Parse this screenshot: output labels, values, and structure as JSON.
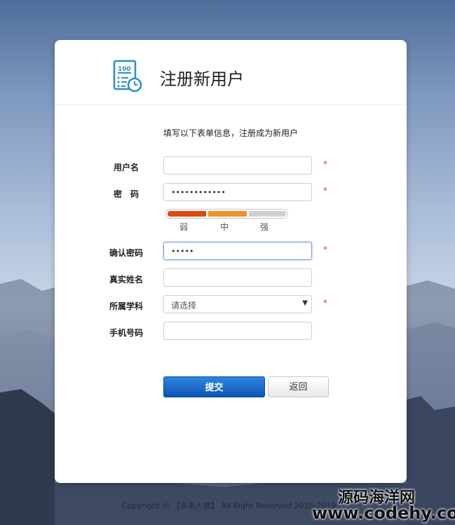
{
  "header": {
    "title": "注册新用户",
    "logo_icon": "exam-score-icon",
    "logo_text": "100"
  },
  "subtitle": "填写以下表单信息，注册成为新用户",
  "form": {
    "username": {
      "label": "用户名",
      "value": "",
      "required": "*"
    },
    "password": {
      "label": "密　码",
      "value": "••••••••••••",
      "required": "*"
    },
    "strength": {
      "weak": "弱",
      "medium": "中",
      "strong": "强",
      "level": 2,
      "colors": [
        "#e04a0f",
        "#f09228",
        "#d0d0d0"
      ]
    },
    "confirm": {
      "label": "确认密码",
      "value": "•••••",
      "required": "*"
    },
    "realname": {
      "label": "真实姓名",
      "value": ""
    },
    "subject": {
      "label": "所属学科",
      "placeholder": "请选择",
      "required": "*"
    },
    "phone": {
      "label": "手机号码",
      "value": ""
    }
  },
  "buttons": {
    "submit": "提交",
    "back": "返回"
  },
  "footer": "Copyright © 【未来人做】 All Right Reserved 2015-2019",
  "watermark": {
    "cn": "源码海洋网",
    "url": "www.codehy.com"
  },
  "colors": {
    "accent": "#0b55b4",
    "required": "#e03a3a"
  }
}
